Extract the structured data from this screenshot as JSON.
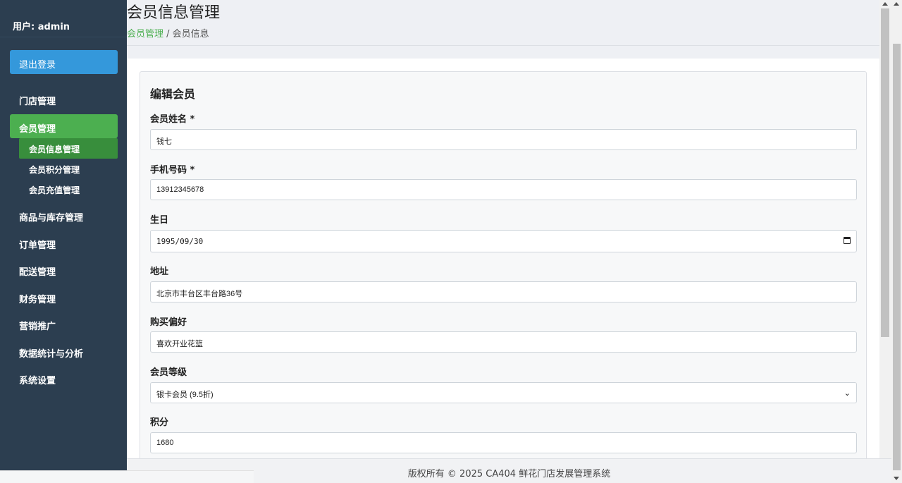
{
  "sidebar": {
    "user_label": "用户: admin",
    "logout_label": "退出登录",
    "items": [
      {
        "label": "门店管理"
      },
      {
        "label": "会员管理"
      },
      {
        "label": "商品与库存管理"
      },
      {
        "label": "订单管理"
      },
      {
        "label": "配送管理"
      },
      {
        "label": "财务管理"
      },
      {
        "label": "营销推广"
      },
      {
        "label": "数据统计与分析"
      },
      {
        "label": "系统设置"
      }
    ],
    "subitems": [
      {
        "label": "会员信息管理"
      },
      {
        "label": "会员积分管理"
      },
      {
        "label": "会员充值管理"
      }
    ]
  },
  "header": {
    "title": "会员信息管理",
    "breadcrumb_link": "会员管理",
    "breadcrumb_sep": " / ",
    "breadcrumb_current": "会员信息"
  },
  "form": {
    "title": "编辑会员",
    "name_label": "会员姓名 *",
    "name_value": "钱七",
    "phone_label": "手机号码 *",
    "phone_value": "13912345678",
    "birthday_label": "生日",
    "birthday_value": "1995/09/30",
    "address_label": "地址",
    "address_value": "北京市丰台区丰台路36号",
    "preference_label": "购买偏好",
    "preference_value": "喜欢开业花篮",
    "level_label": "会员等级",
    "level_value": "银卡会员 (9.5折)",
    "points_label": "积分",
    "points_value": "1680"
  },
  "footer": {
    "copyright": "版权所有 © 2025 CA404 鲜花门店发展管理系统"
  },
  "colors": {
    "sidebar_bg": "#2c3e50",
    "logout_bg": "#3498db",
    "active_green": "#4caf50",
    "sub_active_green": "#388e3c"
  }
}
